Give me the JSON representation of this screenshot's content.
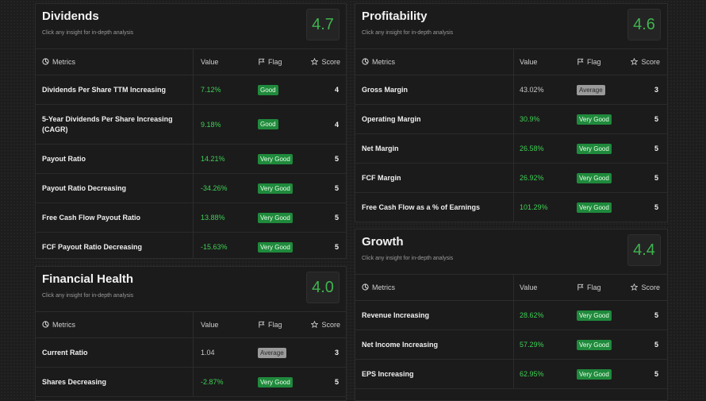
{
  "columns": {
    "metrics": "Metrics",
    "value": "Value",
    "flag": "Flag",
    "score": "Score"
  },
  "panels": {
    "dividends": {
      "title": "Dividends",
      "subtitle": "Click any insight for in-depth analysis",
      "score": "4.7",
      "rows": [
        {
          "metric": "Dividends Per Share TTM Increasing",
          "value": "7.12%",
          "flag": "Good",
          "score": "4"
        },
        {
          "metric": "5-Year Dividends Per Share Increasing (CAGR)",
          "value": "9.18%",
          "flag": "Good",
          "score": "4"
        },
        {
          "metric": "Payout Ratio",
          "value": "14.21%",
          "flag": "Very Good",
          "score": "5"
        },
        {
          "metric": "Payout Ratio Decreasing",
          "value": "-34.26%",
          "flag": "Very Good",
          "score": "5"
        },
        {
          "metric": "Free Cash Flow Payout Ratio",
          "value": "13.88%",
          "flag": "Very Good",
          "score": "5"
        },
        {
          "metric": "FCF Payout Ratio Decreasing",
          "value": "-15.63%",
          "flag": "Very Good",
          "score": "5"
        }
      ]
    },
    "financial_health": {
      "title": "Financial Health",
      "subtitle": "Click any insight for in-depth analysis",
      "score": "4.0",
      "rows": [
        {
          "metric": "Current Ratio",
          "value": "1.04",
          "flag": "Average",
          "score": "3"
        },
        {
          "metric": "Shares Decreasing",
          "value": "-2.87%",
          "flag": "Very Good",
          "score": "5"
        }
      ]
    },
    "profitability": {
      "title": "Profitability",
      "subtitle": "Click any insight for in-depth analysis",
      "score": "4.6",
      "rows": [
        {
          "metric": "Gross Margin",
          "value": "43.02%",
          "flag": "Average",
          "score": "3"
        },
        {
          "metric": "Operating Margin",
          "value": "30.9%",
          "flag": "Very Good",
          "score": "5"
        },
        {
          "metric": "Net Margin",
          "value": "26.58%",
          "flag": "Very Good",
          "score": "5"
        },
        {
          "metric": "FCF Margin",
          "value": "26.92%",
          "flag": "Very Good",
          "score": "5"
        },
        {
          "metric": "Free Cash Flow as a % of Earnings",
          "value": "101.29%",
          "flag": "Very Good",
          "score": "5"
        }
      ]
    },
    "growth": {
      "title": "Growth",
      "subtitle": "Click any insight for in-depth analysis",
      "score": "4.4",
      "rows": [
        {
          "metric": "Revenue Increasing",
          "value": "28.62%",
          "flag": "Very Good",
          "score": "5"
        },
        {
          "metric": "Net Income Increasing",
          "value": "57.29%",
          "flag": "Very Good",
          "score": "5"
        },
        {
          "metric": "EPS Increasing",
          "value": "62.95%",
          "flag": "Very Good",
          "score": "5"
        }
      ]
    }
  }
}
